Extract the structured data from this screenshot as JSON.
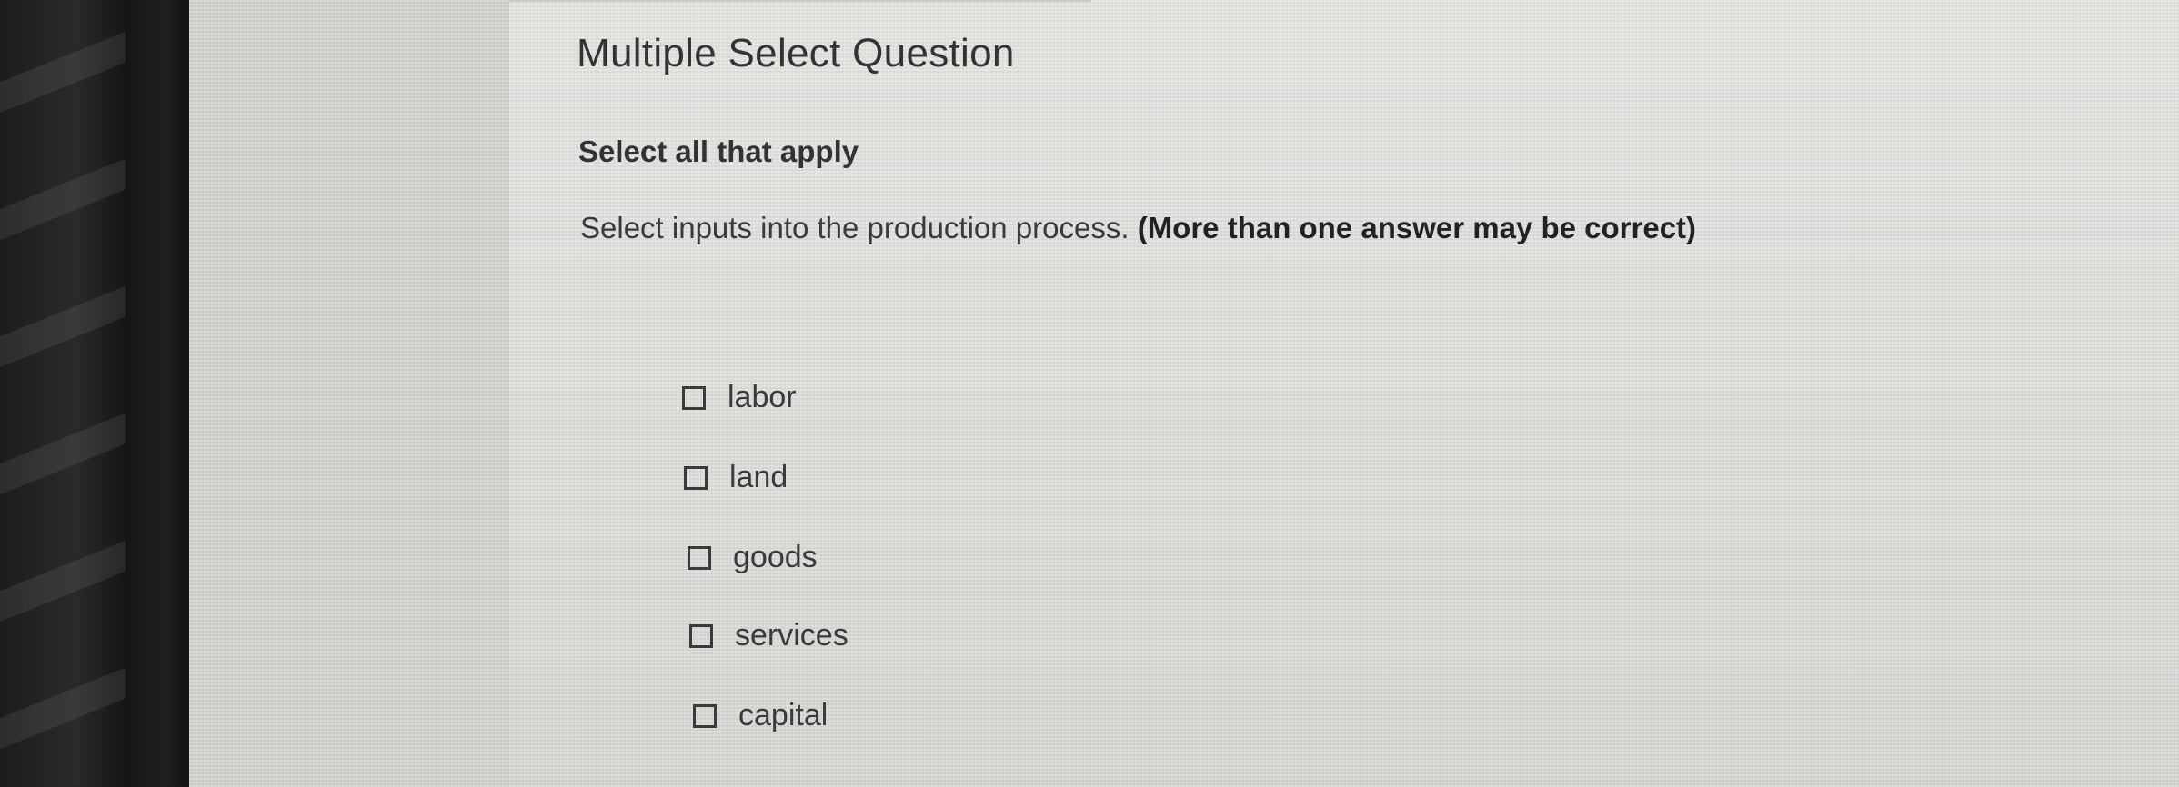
{
  "question": {
    "title": "Multiple Select Question",
    "instruction": "Select all that apply",
    "prompt_text": "Select inputs into the production process. ",
    "prompt_bold": "(More than one answer may be correct)"
  },
  "options": [
    {
      "label": "labor",
      "checked": false
    },
    {
      "label": "land",
      "checked": false
    },
    {
      "label": "goods",
      "checked": false
    },
    {
      "label": "services",
      "checked": false
    },
    {
      "label": "capital",
      "checked": false
    }
  ]
}
